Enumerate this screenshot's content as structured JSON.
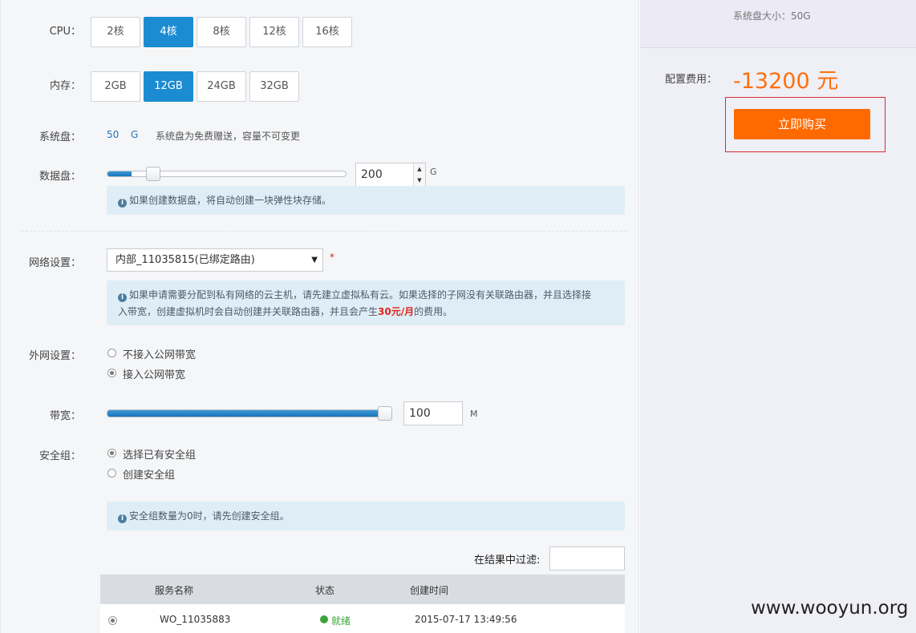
{
  "cpu": {
    "label": "CPU：",
    "options": [
      "2核",
      "4核",
      "8核",
      "12核",
      "16核"
    ],
    "selected": "4核"
  },
  "memory": {
    "label": "内存：",
    "options": [
      "2GB",
      "12GB",
      "24GB",
      "32GB"
    ],
    "selected": "12GB"
  },
  "system_disk": {
    "label": "系统盘：",
    "size": "50",
    "unit": "G",
    "note": "系统盘为免费赠送，容量不可变更"
  },
  "data_disk": {
    "label": "数据盘：",
    "value": "200",
    "unit": "G",
    "slider_fraction": 0.1,
    "tip": "如果创建数据盘，将自动创建一块弹性块存储。"
  },
  "network": {
    "label": "网络设置：",
    "selected": "内部_11035815(已绑定路由)",
    "required_mark": "*",
    "tip_line1": "如果申请需要分配到私有网络的云主机，请先建立虚拟私有云。如果选择的子网没有关联路由器，并且选择接",
    "tip_line2_pre": "入带宽，创建虚拟机时会自动创建并关联路由器，并且会产生",
    "tip_price": "30元/月",
    "tip_line2_post": "的费用。"
  },
  "public_network": {
    "label": "外网设置：",
    "options": [
      "不接入公网带宽",
      "接入公网带宽"
    ],
    "selected_index": 1
  },
  "bandwidth": {
    "label": "带宽：",
    "value": "100",
    "unit": "M",
    "slider_fraction": 1.0
  },
  "security_group": {
    "label": "安全组：",
    "options": [
      "选择已有安全组",
      "创建安全组"
    ],
    "selected_index": 0,
    "tip": "安全组数量为0时，请先创建安全组。"
  },
  "filter": {
    "label": "在结果中过滤:",
    "value": ""
  },
  "table": {
    "headers": [
      "服务名称",
      "状态",
      "创建时间"
    ],
    "rows": [
      {
        "name": "WO_11035883",
        "status": "就绪",
        "created": "2015-07-17 13:49:56",
        "selected": true
      }
    ]
  },
  "summary": {
    "system_disk_text": "系统盘大小：50G",
    "fee_label": "配置费用：",
    "fee_value": "-13200 元",
    "buy_label": "立即购买"
  },
  "watermark": "www.wooyun.org",
  "colors": {
    "accent_blue": "#1b8cd1",
    "buy_orange": "#ff6a00",
    "fee_orange": "#ff6f0c",
    "status_green": "#3aa53a",
    "highlight_red": "#e0241a"
  }
}
